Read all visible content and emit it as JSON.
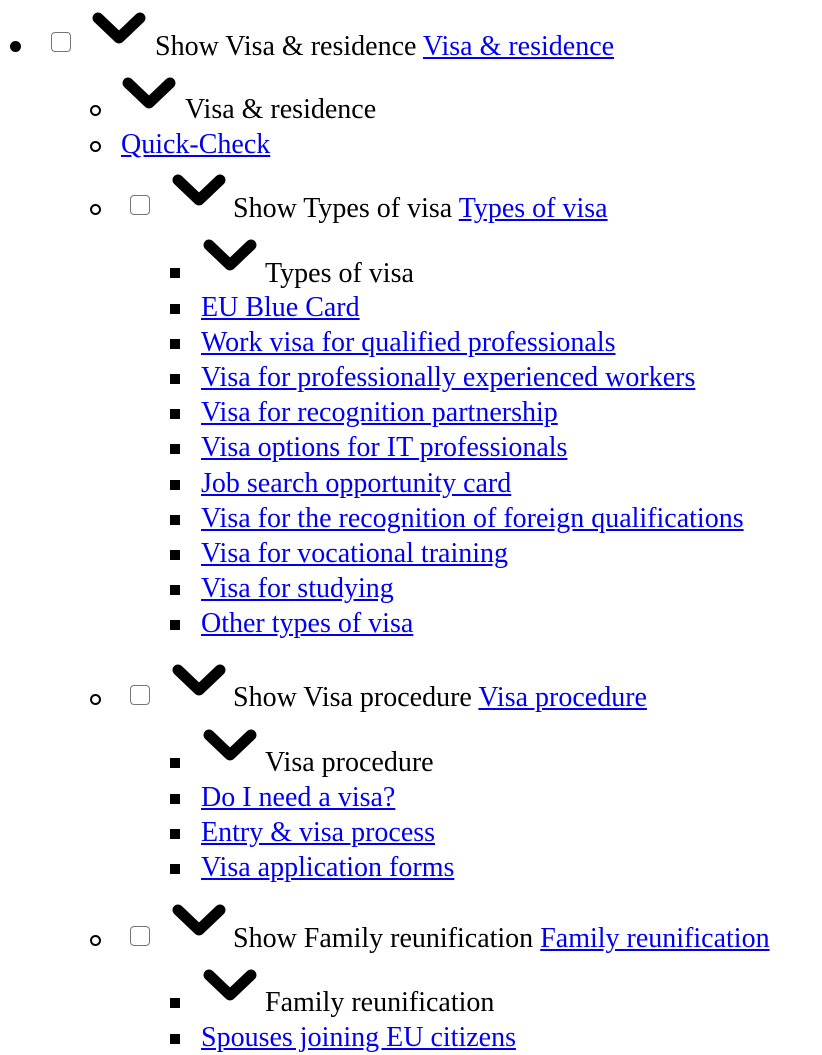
{
  "visa_residence": {
    "toggle_label": "Show Visa & residence",
    "link": "Visa & residence",
    "heading": "Visa & residence",
    "quick_check": "Quick-Check "
  },
  "types_of_visa": {
    "toggle_label": "Show Types of visa",
    "link": "Types of visa ",
    "heading": "Types of visa",
    "items": [
      "EU Blue Card",
      "Work visa for qualified professionals",
      "Visa for professionally experienced workers",
      "Visa for recognition partnership",
      "Visa options for IT professionals",
      "Job search opportunity card",
      "Visa for the recognition of foreign qualifications",
      "Visa for vocational training",
      "Visa for studying",
      "Other types of visa"
    ]
  },
  "visa_procedure": {
    "toggle_label": "Show Visa procedure",
    "link": "Visa procedure ",
    "heading": "Visa procedure",
    "items": [
      "Do I need a visa?",
      "Entry & visa process",
      "Visa application forms"
    ]
  },
  "family_reunification": {
    "toggle_label": "Show Family reunification",
    "link": "Family reunification",
    "heading": "Family reunification",
    "items": [
      "Spouses joining EU citizens"
    ]
  },
  "icons": {
    "chevron": "chevron-down-icon",
    "checkbox": "checkbox-icon"
  }
}
